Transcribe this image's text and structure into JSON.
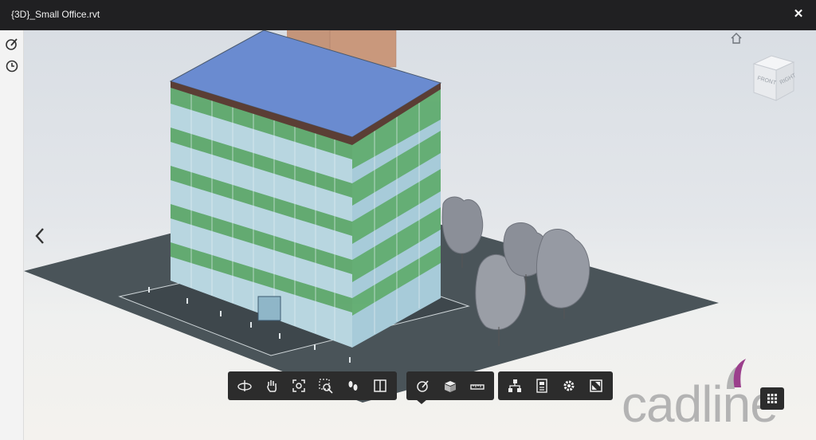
{
  "window": {
    "title": "{3D}_Small Office.rvt",
    "close_glyph": "✕"
  },
  "left_toolbar": {
    "items": [
      {
        "name": "markup-icon"
      },
      {
        "name": "history-clock-icon"
      }
    ]
  },
  "viewcube": {
    "front_label": "FRONT",
    "right_label": "RIGHT"
  },
  "bottom_toolbar": {
    "groups": [
      {
        "tools": [
          "orbit-icon",
          "pan-hand-icon",
          "fit-to-view-icon",
          "zoom-window-icon",
          "first-person-icon",
          "section-icon"
        ]
      },
      {
        "tools": [
          "markup-measure-icon",
          "explode-model-icon",
          "measure-distance-icon"
        ]
      },
      {
        "tools": [
          "model-browser-icon",
          "properties-icon",
          "settings-gear-icon",
          "fullscreen-icon"
        ]
      }
    ]
  },
  "watermark": {
    "brand": "cadline"
  },
  "colors": {
    "titlebar": "#202022",
    "toolbar": "#2c2c2c",
    "roof": "#6a8bd0",
    "facade_green": "#5faa6a",
    "ground": "#4a5459",
    "trees": "#8c9099"
  }
}
